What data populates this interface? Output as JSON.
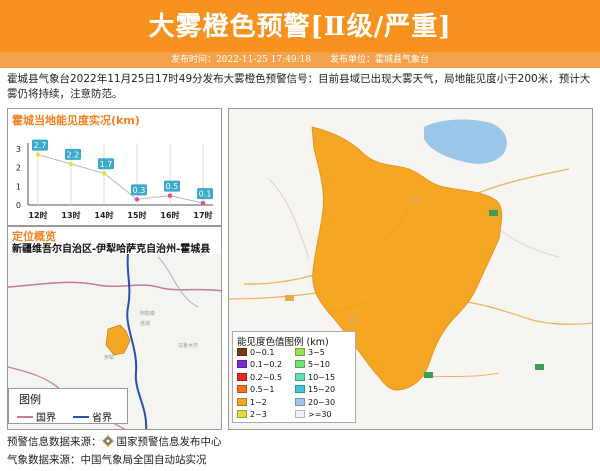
{
  "header": {
    "title": "大雾橙色预警[Ⅱ级/严重]",
    "publish_time_label": "发布时间：2022-11-25 17:49:18",
    "publisher_label": "发布单位：霍城县气象台",
    "bg_color": "#F7921E"
  },
  "description": "霍城县气象台2022年11月25日17时49分发布大雾橙色预警信号：目前县域已出现大雾天气，局地能见度小于200米，预计大雾仍将持续，注意防范。",
  "chart_panel": {
    "title": "霍城当地能见度实况(km)"
  },
  "chart_data": {
    "type": "line",
    "title": "霍城当地能见度实况(km)",
    "categories": [
      "12时",
      "13时",
      "14时",
      "15时",
      "16时",
      "17时"
    ],
    "values": [
      2.7,
      2.2,
      1.7,
      0.3,
      0.5,
      0.1
    ],
    "data_labels": [
      "2.7",
      "2.2",
      "1.7",
      "0.3",
      "0.5",
      "0.1"
    ],
    "y_ticks": [
      "0",
      "1",
      "2",
      "3"
    ],
    "ylim": [
      0,
      3
    ],
    "point_colors": [
      "#E8E23C",
      "#E8E23C",
      "#E8E23C",
      "#E84A8A",
      "#E84A8A",
      "#E84A8A"
    ],
    "label_bg": "#3BA9C9",
    "grid": true
  },
  "location_panel": {
    "title": "定位概览",
    "subtitle": "新疆维吾尔自治区-伊犁哈萨克自治州-霍城县"
  },
  "small_legend": {
    "title": "图例",
    "items": [
      {
        "label": "国界",
        "color": "#C77A9A"
      },
      {
        "label": "省界",
        "color": "#2A4FB5"
      }
    ]
  },
  "vis_legend": {
    "title": "能见度色值图例 (km)",
    "items": [
      {
        "label": "0~0.1",
        "color": "#7A3B10"
      },
      {
        "label": "3~5",
        "color": "#9BE04A"
      },
      {
        "label": "0.1~0.2",
        "color": "#7B2AD4"
      },
      {
        "label": "5~10",
        "color": "#74E07C"
      },
      {
        "label": "0.2~0.5",
        "color": "#E8291E"
      },
      {
        "label": "10~15",
        "color": "#5EDCB8"
      },
      {
        "label": "0.5~1",
        "color": "#F27221"
      },
      {
        "label": "15~20",
        "color": "#3FC6D7"
      },
      {
        "label": "1~2",
        "color": "#F5A623"
      },
      {
        "label": "20~30",
        "color": "#9CC9E6"
      },
      {
        "label": "2~3",
        "color": "#E5DB3B"
      },
      {
        "label": ">=30",
        "color": "#F2F2F2"
      }
    ]
  },
  "sources": {
    "warning_source": "预警信息数据来源：",
    "warning_source_name": "国家预警信息发布中心",
    "weather_source": "气象数据来源：中国气象局全国自动站实况"
  }
}
